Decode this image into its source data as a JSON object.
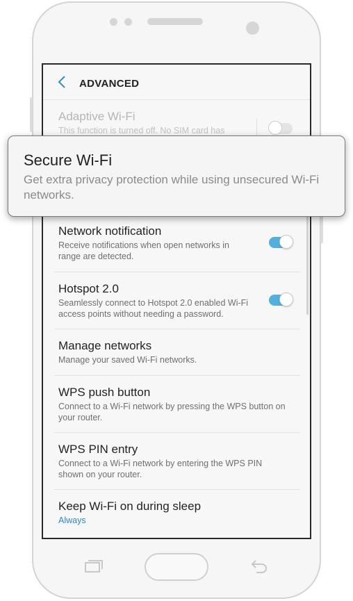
{
  "header": {
    "title": "ADVANCED"
  },
  "settings": [
    {
      "title": "Adaptive Wi-Fi",
      "subtitle": "This function is turned off. No SIM card has",
      "toggle": "off"
    },
    {
      "title": "Network notification",
      "subtitle": "Receive notifications when open networks in range are detected.",
      "toggle": "on"
    },
    {
      "title": "Hotspot 2.0",
      "subtitle": "Seamlessly connect to Hotspot 2.0 enabled Wi-Fi access points without needing a password.",
      "toggle": "on"
    },
    {
      "title": "Manage networks",
      "subtitle": "Manage your saved Wi-Fi networks."
    },
    {
      "title": "WPS push button",
      "subtitle": "Connect to a Wi-Fi network by pressing the WPS button on your router."
    },
    {
      "title": "WPS PIN entry",
      "subtitle": "Connect to a Wi-Fi network by entering the WPS PIN shown on your router."
    },
    {
      "title": "Keep Wi-Fi on during sleep",
      "subtitle": "Always"
    }
  ],
  "callout": {
    "title": "Secure Wi-Fi",
    "subtitle": "Get extra privacy protection while using unsecured Wi-Fi networks."
  },
  "colors": {
    "accent": "#2f88c0",
    "toggle_on": "#53b0dd"
  },
  "icons": {
    "back": "chevron-left-icon",
    "recents": "recent-apps-icon",
    "back_key": "back-arrow-icon"
  }
}
